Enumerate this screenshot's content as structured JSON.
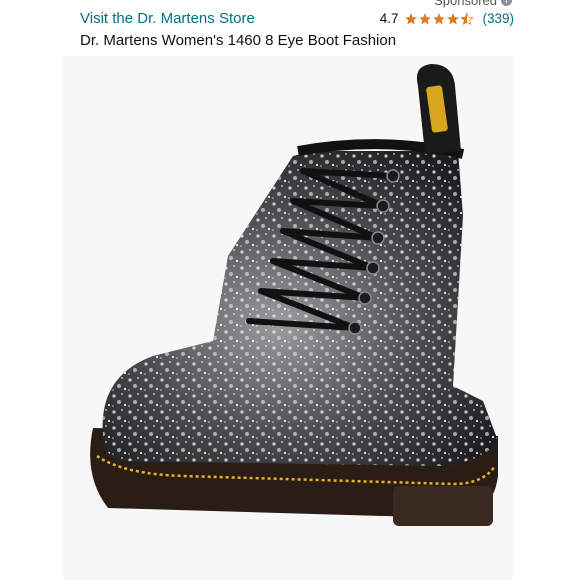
{
  "sponsored": {
    "label": "Sponsored"
  },
  "store": {
    "link_text": "Visit the Dr. Martens Store"
  },
  "rating": {
    "value": "4.7",
    "stars": 4.5,
    "review_count": "(339)"
  },
  "product": {
    "title": "Dr. Martens Women's 1460 8 Eye Boot Fashion"
  },
  "colors": {
    "link": "#007185",
    "star": "#de7921",
    "text": "#0f1111"
  }
}
